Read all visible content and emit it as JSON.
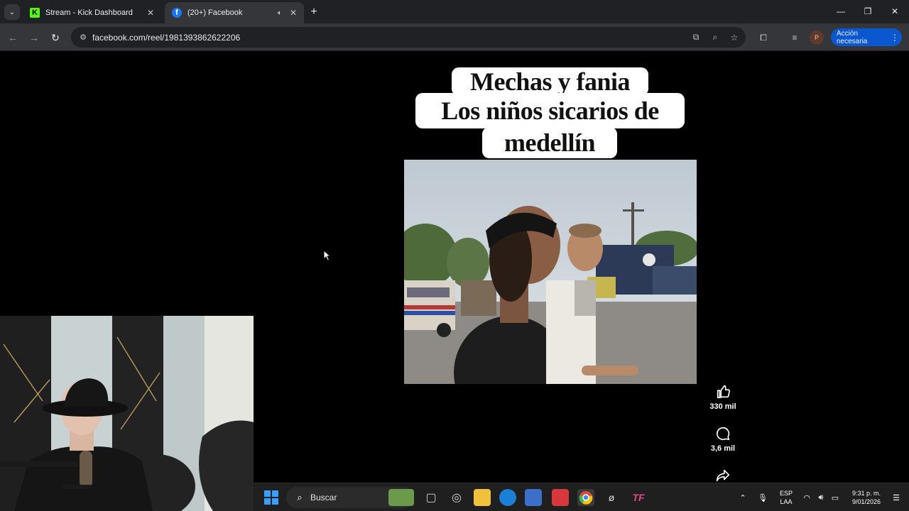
{
  "browser": {
    "tabs": [
      {
        "title": "Stream - Kick Dashboard",
        "favicon": "kick-icon",
        "active": false
      },
      {
        "title": "(20+) Facebook",
        "favicon": "facebook-icon",
        "active": true
      }
    ],
    "url": "facebook.com/reel/1981393862622206",
    "profile_initial": "P",
    "action_button_label": "Acción necesaria",
    "accent_color": "#0b57d0"
  },
  "reel": {
    "caption_lines": [
      "Mechas y fania",
      "Los niños sicarios de",
      "medellín"
    ],
    "likes": "330 mil",
    "comments": "3,6 mil"
  },
  "taskbar": {
    "search_placeholder": "Buscar",
    "language": "ESP",
    "language_sub": "LAA",
    "time": "9:31 p. m.",
    "date": "9/01/2026"
  }
}
